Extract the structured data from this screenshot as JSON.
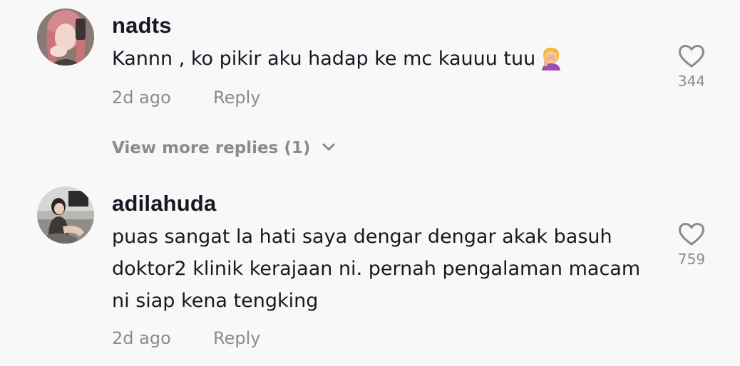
{
  "comments": [
    {
      "username": "nadts",
      "text": "Kannn , ko pikir aku hadap ke mc kauuu tuu",
      "emoji": "woman-facepalming-emoji",
      "time": "2d ago",
      "reply_label": "Reply",
      "likes": "344",
      "view_more": "View more replies (1)"
    },
    {
      "username": "adilahuda",
      "text": "puas sangat la hati saya dengar dengar akak basuh doktor2 klinik kerajaan ni. pernah pengalaman macam ni siap kena tengking",
      "time": "2d ago",
      "reply_label": "Reply",
      "likes": "759"
    }
  ],
  "icons": {
    "like": "heart-outline-icon",
    "expand": "chevron-down-icon"
  },
  "colors": {
    "background": "#f8f8f8",
    "primary_text": "#161823",
    "secondary_text": "#8a8b91"
  }
}
